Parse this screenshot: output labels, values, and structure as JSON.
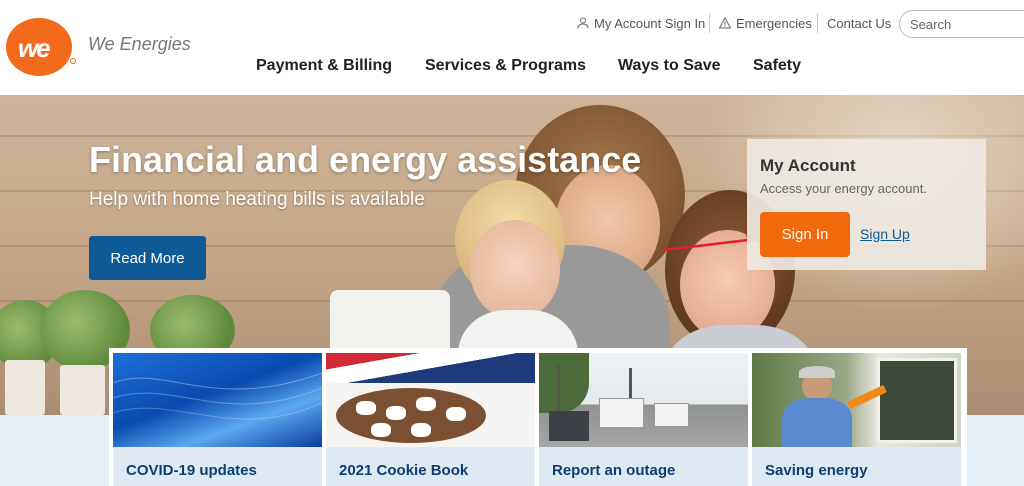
{
  "brand": {
    "logo_text": "we",
    "name": "We Energies"
  },
  "utility_nav": {
    "account_sign_in": "My Account Sign In",
    "emergencies": "Emergencies",
    "contact_us": "Contact Us",
    "search_placeholder": "Search"
  },
  "main_nav": [
    {
      "label": "Payment & Billing"
    },
    {
      "label": "Services & Programs"
    },
    {
      "label": "Ways to Save"
    },
    {
      "label": "Safety"
    }
  ],
  "hero": {
    "title": "Financial and energy assistance",
    "subtitle": "Help with home heating bills is available",
    "button_label": "Read More"
  },
  "account_panel": {
    "title": "My Account",
    "description": "Access your energy account.",
    "sign_in_label": "Sign In",
    "sign_up_label": "Sign Up"
  },
  "cards": [
    {
      "label": "COVID-19 updates"
    },
    {
      "label": "2021 Cookie Book"
    },
    {
      "label": "Report an outage"
    },
    {
      "label": "Saving energy"
    }
  ],
  "colors": {
    "brand_orange": "#f26a1b",
    "primary_blue": "#0d5a96",
    "sign_in_orange": "#f26a0c",
    "card_label_text": "#0d3f73",
    "annotation_arrow": "#e4202a"
  }
}
